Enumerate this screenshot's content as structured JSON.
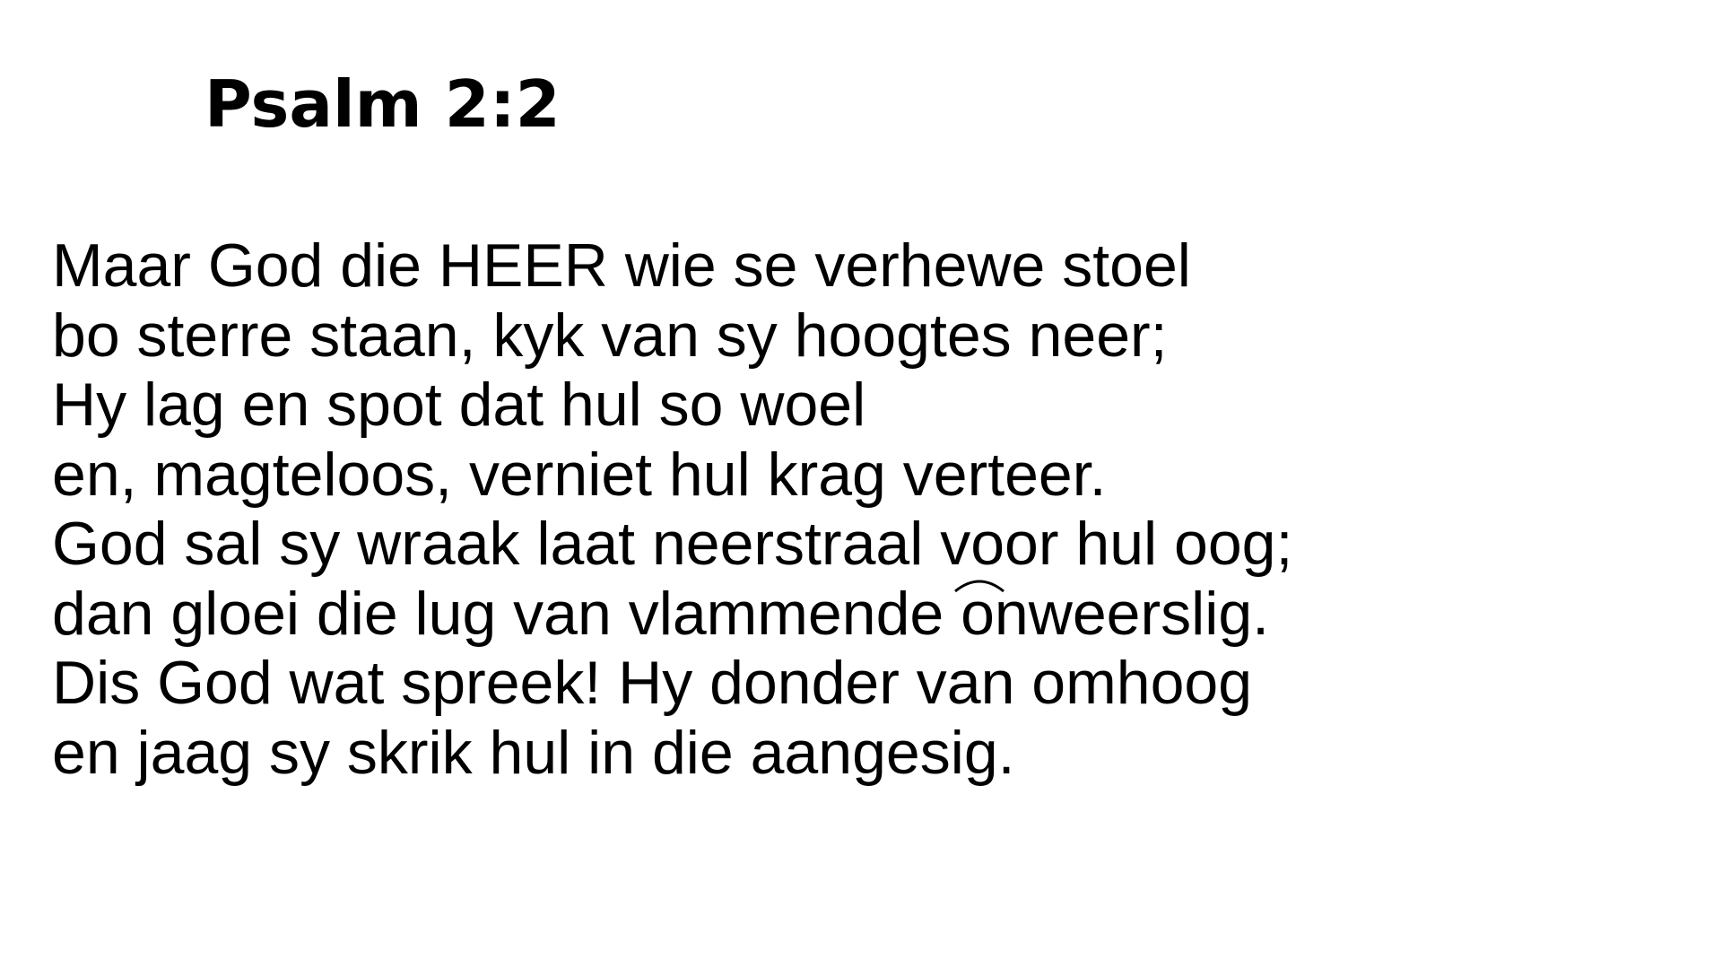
{
  "slide": {
    "title": "Psalm 2:2",
    "lines": [
      "Maar God die HEER wie se verhewe stoel",
      "bo sterre staan, kyk van sy hoogtes neer;",
      "Hy lag en spot dat hul so woel",
      "en, magteloos, verniet hul krag verteer.",
      "God sal sy wraak laat neerstraal voor hul oog;",
      {
        "before": "dan gloei die lug van vlammende",
        "after": "onweerslig."
      },
      "Dis God wat spreek! Hy donder van omhoog",
      "en jaag sy skrik hul in die aangesig."
    ],
    "elision_icon": "elision-arc-icon"
  },
  "colors": {
    "background": "#ffffff",
    "text": "#000000"
  }
}
